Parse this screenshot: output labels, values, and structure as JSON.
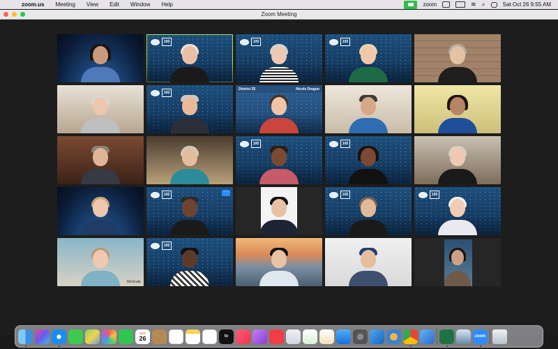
{
  "menubar": {
    "app_name": "zoom.us",
    "items": [
      "Meeting",
      "View",
      "Edit",
      "Window",
      "Help"
    ],
    "status_app": "zoom",
    "datetime": "Sat Oct 26  9:55 AM"
  },
  "window": {
    "title": "Zoom Meeting"
  },
  "gallery": {
    "logo_text": "100",
    "district_banner_left": "District 25",
    "district_banner_right": "Nicole Dragun",
    "tile_more": "···",
    "watermark": "McGrady"
  },
  "dock": {
    "calendar_month": "OCT",
    "calendar_day": "26",
    "apple_tv_label": "tv",
    "zoom_label": "zoom"
  },
  "colors": {
    "active_speaker_border": "#9ee35e",
    "zoom_green": "#2ebd4e",
    "zoom_blue": "#2d8cff"
  }
}
